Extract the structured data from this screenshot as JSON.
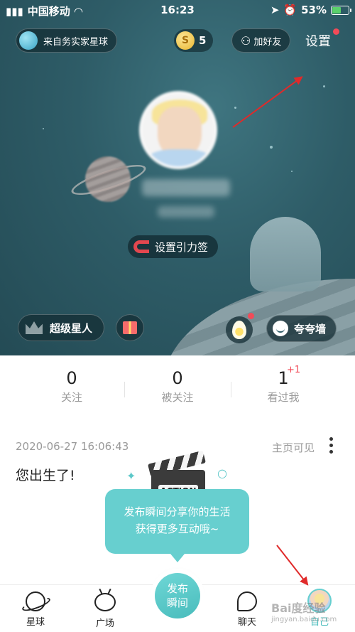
{
  "status_bar": {
    "carrier": "中国移动",
    "time": "16:23",
    "battery": "53%",
    "battery_level": 0.53
  },
  "header": {
    "origin_label": "来自务实家星球",
    "coins": "5",
    "coin_symbol": "S",
    "add_friend": "加好友",
    "settings": "设置"
  },
  "profile": {
    "gravity_tag": "设置引力签",
    "super_star": "超级星人",
    "praise_wall": "夸夸墙"
  },
  "stats": [
    {
      "value": "0",
      "label": "关注"
    },
    {
      "value": "0",
      "label": "被关注"
    },
    {
      "value": "1",
      "label": "看过我",
      "badge": "+1"
    }
  ],
  "post": {
    "date": "2020-06-27 16:06:43",
    "visibility": "主页可见",
    "text": "您出生了!"
  },
  "tooltip": {
    "clapper_label": "ACTION",
    "line1": "发布瞬间分享你的生活",
    "line2": "获得更多互动哦~"
  },
  "tabbar": {
    "planet": "星球",
    "square": "广场",
    "publish_line1": "发布",
    "publish_line2": "瞬间",
    "chat": "聊天",
    "me": "自己"
  },
  "watermark": {
    "brand": "Bai度经验",
    "url": "jingyan.baidu.com"
  },
  "colors": {
    "hero_bg": "#2e5c67",
    "accent": "#67cfcf",
    "alert_dot": "#f14b58",
    "annotation_arrow": "#e02a2a"
  }
}
